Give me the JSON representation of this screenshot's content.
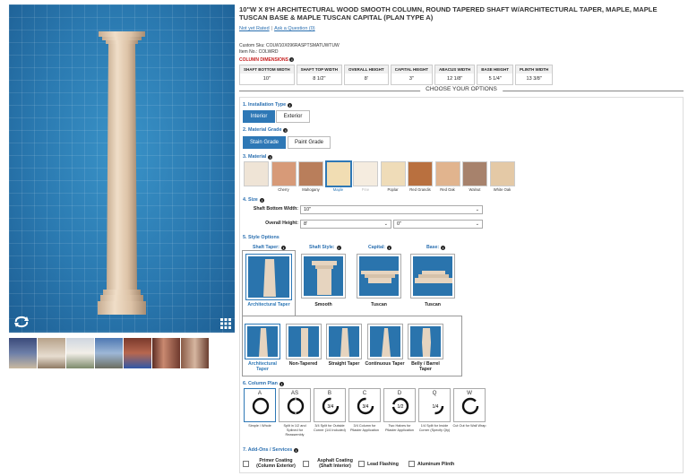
{
  "product": {
    "title": "10\"W X 8'H ARCHITECTURAL WOOD SMOOTH COLUMN, ROUND TAPERED SHAFT W/ARCHITECTURAL TAPER, MAPLE, MAPLE TUSCAN BASE & MAPLE TUSCAN CAPITAL (PLAN TYPE A)",
    "rating_link": "Not yet Rated",
    "question_link": "Ask a Question (0)",
    "custom_sku": "Custom Sku: COLW10X096RASPTSMATUWTUW",
    "item_no": "Item No.: COLWRD"
  },
  "dimensions": {
    "heading": "COLUMN DIMENSIONS",
    "columns": [
      {
        "label": "SHAFT BOTTOM WIDTH",
        "value": "10\""
      },
      {
        "label": "SHAFT TOP WIDTH",
        "value": "8 1/2\""
      },
      {
        "label": "OVERALL HEIGHT",
        "value": "8'"
      },
      {
        "label": "CAPITAL HEIGHT",
        "value": "3\""
      },
      {
        "label": "ABACUS WIDTH",
        "value": "12 1/8\""
      },
      {
        "label": "BASE HEIGHT",
        "value": "5 1/4\""
      },
      {
        "label": "PLINTH WIDTH",
        "value": "13 3/8\""
      }
    ]
  },
  "choose_label": "CHOOSE YOUR OPTIONS",
  "installation": {
    "title": "1. Installation Type",
    "options": [
      "Interior",
      "Exterior"
    ],
    "selected": 0
  },
  "grade": {
    "title": "2. Material Grade",
    "options": [
      "Stain Grade",
      "Paint Grade"
    ],
    "selected": 0
  },
  "material": {
    "title": "3. Material",
    "swatches": [
      {
        "name": "",
        "color": "#efe4d6"
      },
      {
        "name": "Cherry",
        "color": "#d79a78"
      },
      {
        "name": "Mahogany",
        "color": "#b97e5b"
      },
      {
        "name": "Maple",
        "color": "#f1ddb3"
      },
      {
        "name": "Pine",
        "color": "#f5ecdf"
      },
      {
        "name": "Poplar",
        "color": "#efdcb8"
      },
      {
        "name": "Red Grandis",
        "color": "#b9703f"
      },
      {
        "name": "Red Oak",
        "color": "#e1b48e"
      },
      {
        "name": "Walnut",
        "color": "#a7826c"
      },
      {
        "name": "White Oak",
        "color": "#e4c9a6"
      }
    ],
    "selected": 3
  },
  "size": {
    "title": "4. Size",
    "shaft_label": "Shaft Bottom Width:",
    "shaft_value": "10\"",
    "height_label": "Overall Height:",
    "height_ft": "8'",
    "height_in": "0\""
  },
  "style": {
    "title": "5. Style Options",
    "heads": [
      "Shaft Taper:",
      "Shaft Style:",
      "Capital:",
      "Base:"
    ],
    "captions": [
      "Architectural Taper",
      "Smooth",
      "Tuscan",
      "Tuscan"
    ],
    "taper_options": [
      "Architectural Taper",
      "Non-Tapered",
      "Straight Taper",
      "Continuous Taper",
      "Belly / Barrel Taper"
    ]
  },
  "plan": {
    "title": "6. Column Plan",
    "items": [
      {
        "letter": "A",
        "desc": "Simple / Whole",
        "inner": ""
      },
      {
        "letter": "AS",
        "desc": "Split in 1/2 and Splined for Reassembly",
        "inner": ""
      },
      {
        "letter": "B",
        "desc": "3/4 Split for Outside Corner (1/4 Included)",
        "inner": "3/4"
      },
      {
        "letter": "C",
        "desc": "3/4 Column for Pilaster Application",
        "inner": "3/4"
      },
      {
        "letter": "D",
        "desc": "Two Halves for Pilaster Application",
        "inner": "1/2"
      },
      {
        "letter": "Q",
        "desc": "1/4 Split for Inside Corner (Specify Qty)",
        "inner": "1/4"
      },
      {
        "letter": "W",
        "desc": "Cut Out for Wall Wrap",
        "inner": ""
      }
    ]
  },
  "addons": {
    "title": "7. Add-Ons / Services",
    "items": [
      "Primer Coating (Column Exterior)",
      "Asphalt Coating (Shaft Interior)",
      "Lead Flashing",
      "Aluminum Plinth"
    ]
  },
  "colors": {
    "accent": "#2e78b6",
    "viewer_bg": "#2a79b0",
    "link": "#2a6fb0",
    "alert": "#c62020"
  },
  "icons": {
    "rotate": "rotate-360-icon",
    "grid": "grid-view-icon",
    "info": "info-icon"
  }
}
